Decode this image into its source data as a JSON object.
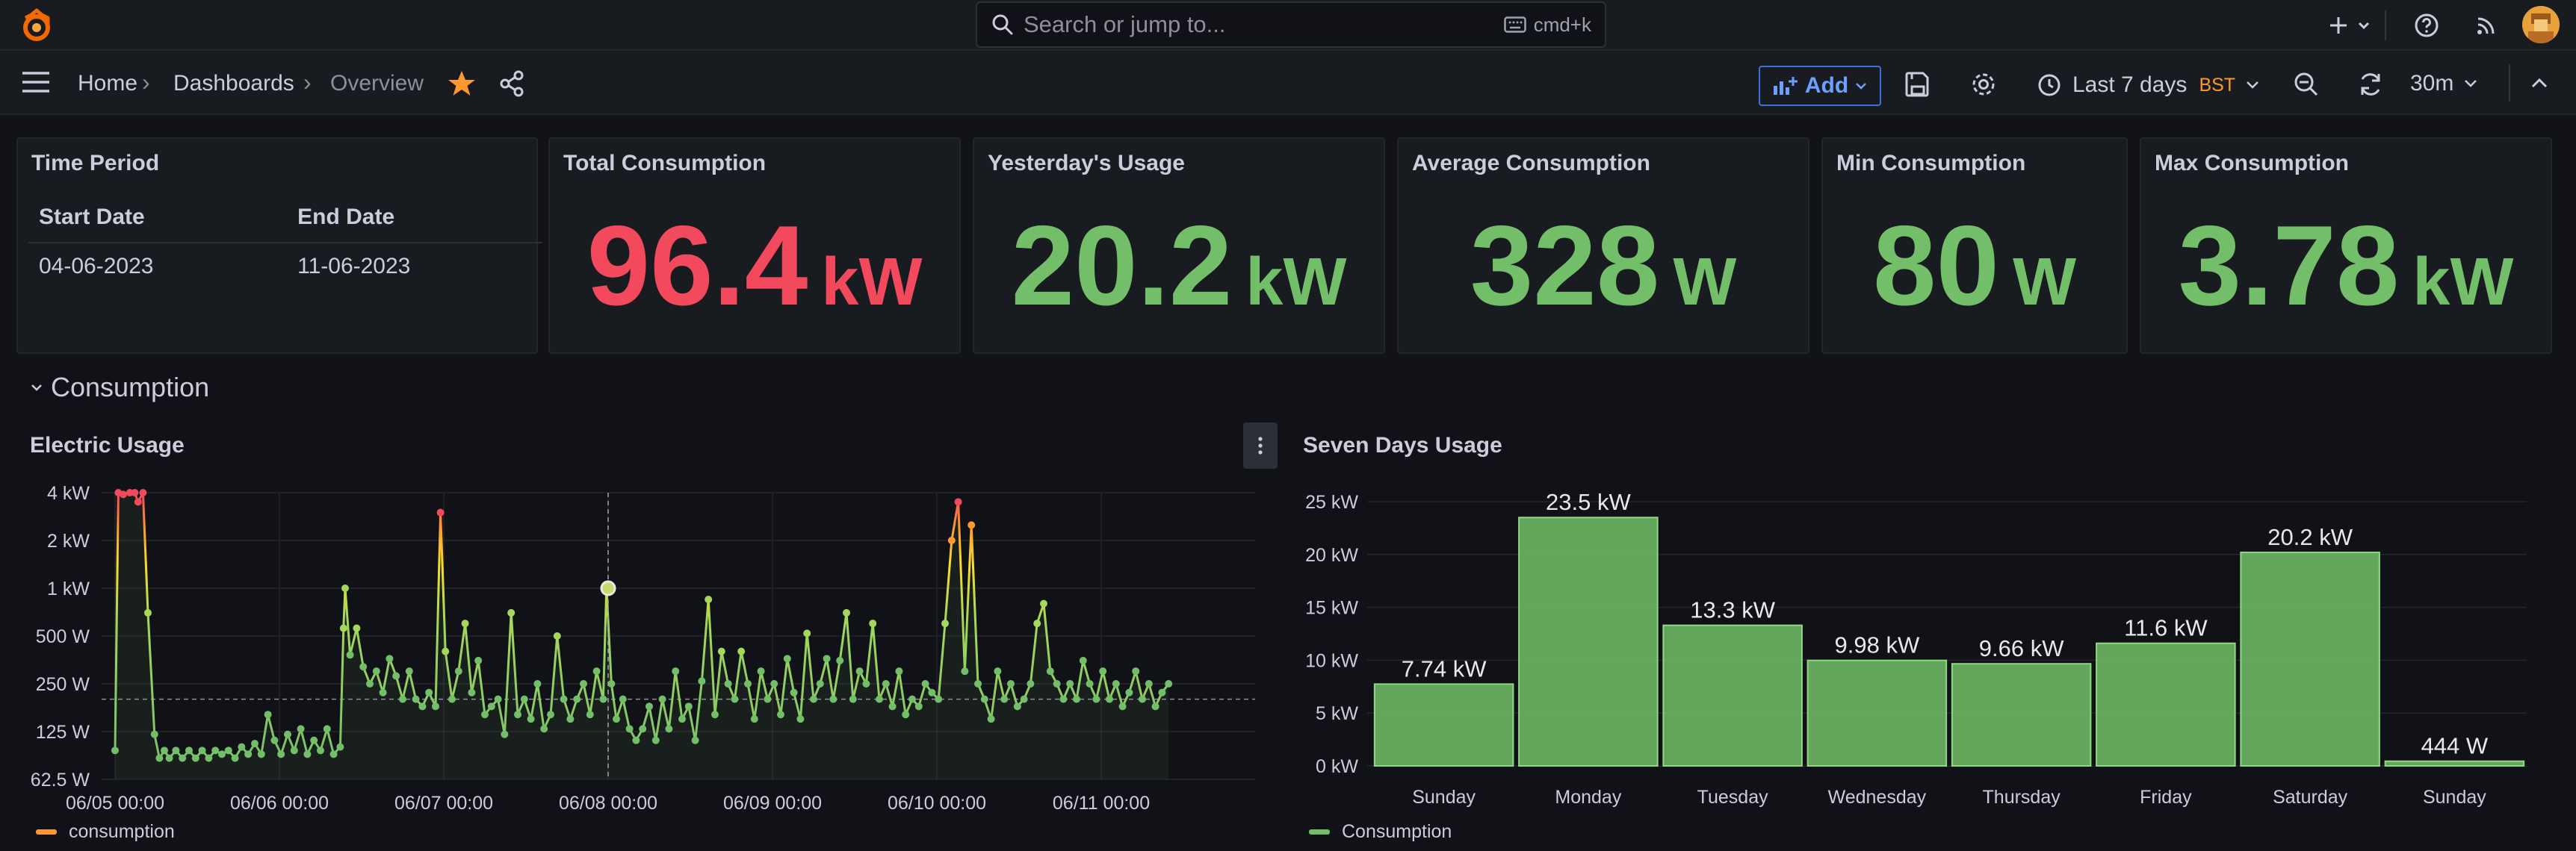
{
  "colors": {
    "bg": "#111217",
    "panel": "#181b1f",
    "red": "#f2495c",
    "green": "#73bf69",
    "accent": "#3d71d9",
    "orange": "#ff9830"
  },
  "topbar": {
    "logo_icon": "grafana-logo-icon",
    "search": {
      "placeholder": "Search or jump to...",
      "shortcut": "cmd+k"
    },
    "icons": [
      "plus-icon",
      "chevron-down-icon",
      "help-icon",
      "rss-icon",
      "avatar"
    ]
  },
  "navbar": {
    "breadcrumb": [
      "Home",
      "Dashboards",
      "Overview"
    ],
    "add_label": "Add",
    "time_range": "Last 7 days",
    "timezone": "BST",
    "refresh_interval": "30m"
  },
  "time_period": {
    "title": "Time Period",
    "columns": [
      "Start Date",
      "End Date"
    ],
    "rows": [
      [
        "04-06-2023",
        "11-06-2023"
      ]
    ]
  },
  "stats": [
    {
      "title": "Total Consumption",
      "value": "96.4",
      "unit": "kW",
      "color": "#f2495c"
    },
    {
      "title": "Yesterday's Usage",
      "value": "20.2",
      "unit": "kW",
      "color": "#73bf69"
    },
    {
      "title": "Average Consumption",
      "value": "328",
      "unit": "W",
      "color": "#73bf69"
    },
    {
      "title": "Min Consumption",
      "value": "80",
      "unit": "W",
      "color": "#73bf69"
    },
    {
      "title": "Max Consumption",
      "value": "3.78",
      "unit": "kW",
      "color": "#73bf69"
    }
  ],
  "row": {
    "title": "Consumption"
  },
  "chart_data": [
    {
      "type": "line",
      "title": "Electric Usage",
      "y_scale": "log2",
      "y_ticks": [
        "4 kW",
        "2 kW",
        "1 kW",
        "500 W",
        "250 W",
        "125 W",
        "62.5 W"
      ],
      "y_tick_values": [
        4000,
        2000,
        1000,
        500,
        250,
        125,
        62.5
      ],
      "x_ticks": [
        "06/05 00:00",
        "06/06 00:00",
        "06/07 00:00",
        "06/08 00:00",
        "06/09 00:00",
        "06/10 00:00",
        "06/11 00:00"
      ],
      "x_days": [
        0,
        1,
        2,
        3,
        4,
        5,
        6
      ],
      "threshold_w": 200,
      "series": [
        {
          "name": "consumption",
          "color": "#ff9830",
          "points": [
            [
              0.0,
              95
            ],
            [
              0.02,
              4000
            ],
            [
              0.05,
              3900
            ],
            [
              0.09,
              4000
            ],
            [
              0.12,
              4000
            ],
            [
              0.14,
              3500
            ],
            [
              0.17,
              4000
            ],
            [
              0.2,
              700
            ],
            [
              0.24,
              120
            ],
            [
              0.27,
              85
            ],
            [
              0.3,
              95
            ],
            [
              0.33,
              85
            ],
            [
              0.37,
              95
            ],
            [
              0.41,
              85
            ],
            [
              0.45,
              95
            ],
            [
              0.49,
              85
            ],
            [
              0.53,
              95
            ],
            [
              0.57,
              85
            ],
            [
              0.61,
              95
            ],
            [
              0.65,
              90
            ],
            [
              0.69,
              95
            ],
            [
              0.73,
              85
            ],
            [
              0.77,
              100
            ],
            [
              0.81,
              90
            ],
            [
              0.85,
              105
            ],
            [
              0.89,
              90
            ],
            [
              0.93,
              160
            ],
            [
              0.97,
              110
            ],
            [
              1.01,
              90
            ],
            [
              1.05,
              120
            ],
            [
              1.09,
              95
            ],
            [
              1.13,
              130
            ],
            [
              1.17,
              90
            ],
            [
              1.21,
              110
            ],
            [
              1.25,
              95
            ],
            [
              1.29,
              130
            ],
            [
              1.33,
              90
            ],
            [
              1.37,
              100
            ],
            [
              1.39,
              560
            ],
            [
              1.4,
              1000
            ],
            [
              1.43,
              380
            ],
            [
              1.47,
              560
            ],
            [
              1.51,
              320
            ],
            [
              1.55,
              250
            ],
            [
              1.59,
              300
            ],
            [
              1.63,
              220
            ],
            [
              1.67,
              360
            ],
            [
              1.71,
              280
            ],
            [
              1.75,
              200
            ],
            [
              1.79,
              300
            ],
            [
              1.83,
              200
            ],
            [
              1.87,
              180
            ],
            [
              1.91,
              220
            ],
            [
              1.95,
              180
            ],
            [
              1.98,
              3000
            ],
            [
              2.01,
              400
            ],
            [
              2.05,
              200
            ],
            [
              2.09,
              300
            ],
            [
              2.13,
              600
            ],
            [
              2.17,
              220
            ],
            [
              2.21,
              350
            ],
            [
              2.25,
              160
            ],
            [
              2.29,
              180
            ],
            [
              2.33,
              200
            ],
            [
              2.37,
              120
            ],
            [
              2.41,
              700
            ],
            [
              2.45,
              160
            ],
            [
              2.49,
              200
            ],
            [
              2.53,
              150
            ],
            [
              2.57,
              250
            ],
            [
              2.61,
              130
            ],
            [
              2.65,
              160
            ],
            [
              2.69,
              500
            ],
            [
              2.73,
              200
            ],
            [
              2.77,
              150
            ],
            [
              2.81,
              200
            ],
            [
              2.85,
              250
            ],
            [
              2.89,
              160
            ],
            [
              2.93,
              300
            ],
            [
              2.97,
              200
            ],
            [
              2.99,
              1000
            ],
            [
              3.02,
              250
            ],
            [
              3.05,
              150
            ],
            [
              3.09,
              200
            ],
            [
              3.13,
              130
            ],
            [
              3.17,
              110
            ],
            [
              3.21,
              130
            ],
            [
              3.25,
              180
            ],
            [
              3.29,
              110
            ],
            [
              3.33,
              200
            ],
            [
              3.37,
              130
            ],
            [
              3.41,
              300
            ],
            [
              3.45,
              150
            ],
            [
              3.49,
              180
            ],
            [
              3.53,
              110
            ],
            [
              3.57,
              260
            ],
            [
              3.61,
              850
            ],
            [
              3.65,
              160
            ],
            [
              3.69,
              400
            ],
            [
              3.73,
              250
            ],
            [
              3.77,
              200
            ],
            [
              3.81,
              400
            ],
            [
              3.85,
              250
            ],
            [
              3.89,
              150
            ],
            [
              3.93,
              300
            ],
            [
              3.97,
              200
            ],
            [
              4.01,
              250
            ],
            [
              4.05,
              160
            ],
            [
              4.09,
              360
            ],
            [
              4.13,
              220
            ],
            [
              4.17,
              150
            ],
            [
              4.21,
              520
            ],
            [
              4.25,
              200
            ],
            [
              4.29,
              250
            ],
            [
              4.33,
              360
            ],
            [
              4.37,
              200
            ],
            [
              4.41,
              350
            ],
            [
              4.45,
              700
            ],
            [
              4.49,
              200
            ],
            [
              4.53,
              300
            ],
            [
              4.57,
              250
            ],
            [
              4.61,
              600
            ],
            [
              4.65,
              200
            ],
            [
              4.69,
              250
            ],
            [
              4.73,
              180
            ],
            [
              4.77,
              300
            ],
            [
              4.81,
              160
            ],
            [
              4.85,
              200
            ],
            [
              4.89,
              180
            ],
            [
              4.93,
              250
            ],
            [
              4.97,
              220
            ],
            [
              5.01,
              200
            ],
            [
              5.05,
              600
            ],
            [
              5.09,
              2000
            ],
            [
              5.13,
              3500
            ],
            [
              5.17,
              300
            ],
            [
              5.21,
              2500
            ],
            [
              5.25,
              250
            ],
            [
              5.29,
              200
            ],
            [
              5.33,
              150
            ],
            [
              5.37,
              300
            ],
            [
              5.41,
              200
            ],
            [
              5.45,
              250
            ],
            [
              5.49,
              180
            ],
            [
              5.53,
              200
            ],
            [
              5.57,
              250
            ],
            [
              5.61,
              600
            ],
            [
              5.65,
              800
            ],
            [
              5.69,
              300
            ],
            [
              5.73,
              250
            ],
            [
              5.77,
              200
            ],
            [
              5.81,
              250
            ],
            [
              5.85,
              200
            ],
            [
              5.89,
              350
            ],
            [
              5.93,
              250
            ],
            [
              5.97,
              200
            ],
            [
              6.01,
              300
            ],
            [
              6.05,
              200
            ],
            [
              6.09,
              250
            ],
            [
              6.13,
              180
            ],
            [
              6.17,
              220
            ],
            [
              6.21,
              300
            ],
            [
              6.25,
              200
            ],
            [
              6.29,
              250
            ],
            [
              6.33,
              180
            ],
            [
              6.37,
              220
            ],
            [
              6.41,
              250
            ]
          ]
        }
      ],
      "hover": {
        "x": 3.0,
        "y": 1000
      }
    },
    {
      "type": "bar",
      "title": "Seven Days Usage",
      "categories": [
        "Sunday",
        "Monday",
        "Tuesday",
        "Wednesday",
        "Thursday",
        "Friday",
        "Saturday",
        "Sunday"
      ],
      "values": [
        7.74,
        23.5,
        13.3,
        9.98,
        9.66,
        11.6,
        20.2,
        0.444
      ],
      "value_labels": [
        "7.74 kW",
        "23.5 kW",
        "13.3 kW",
        "9.98 kW",
        "9.66 kW",
        "11.6 kW",
        "20.2 kW",
        "444 W"
      ],
      "y_ticks": [
        "25 kW",
        "20 kW",
        "15 kW",
        "10 kW",
        "5 kW",
        "0 kW"
      ],
      "ylim": [
        0,
        25
      ],
      "series": [
        {
          "name": "Consumption",
          "color": "#73bf69"
        }
      ]
    }
  ]
}
